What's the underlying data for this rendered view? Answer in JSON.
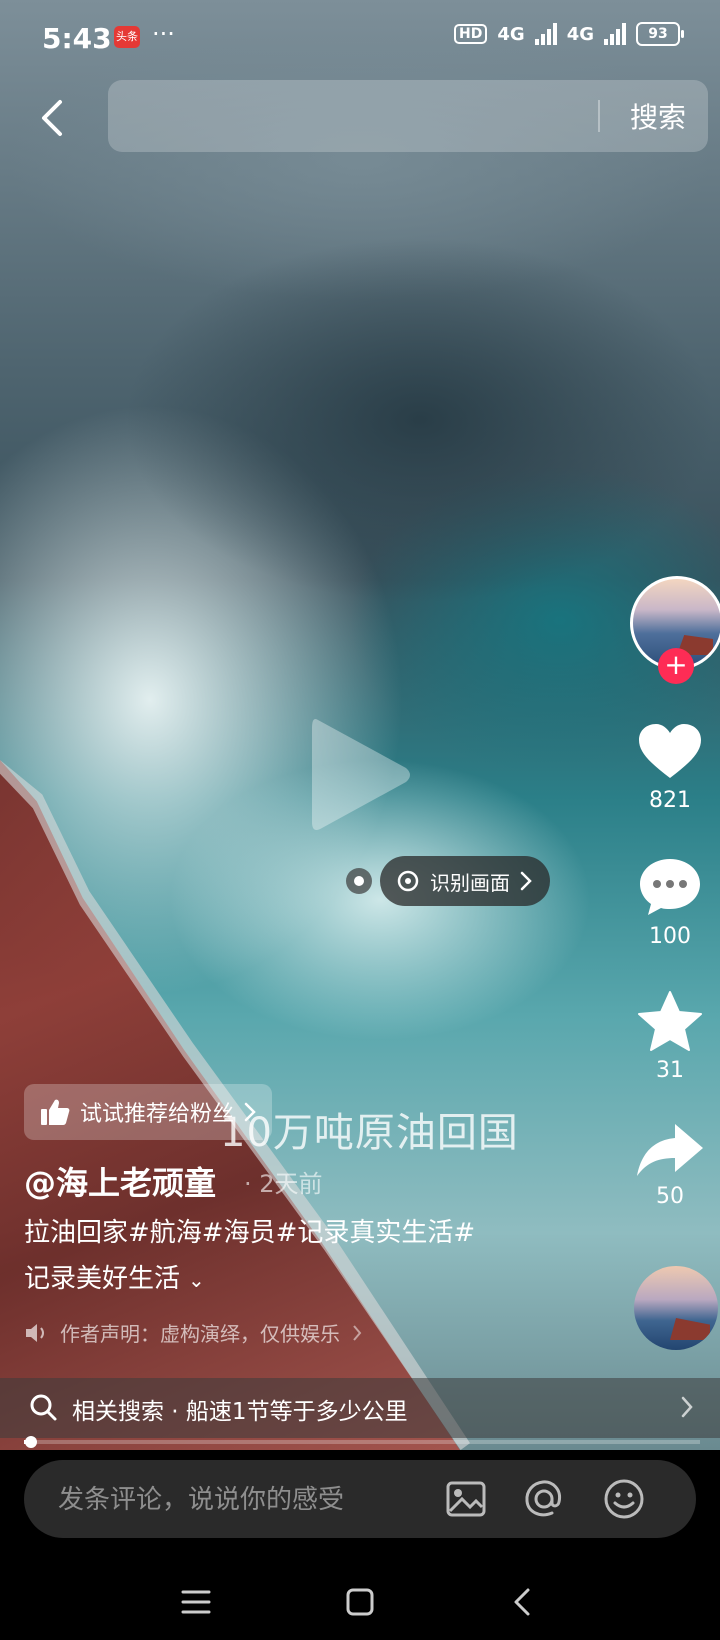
{
  "status_bar": {
    "time": "5:43",
    "app_badge": "头条",
    "more": "···",
    "hd": "HD",
    "net1": "4G",
    "net2": "4G",
    "battery": "93"
  },
  "search": {
    "placeholder": "",
    "button_label": "搜索"
  },
  "video": {
    "identify_label": "识别画面",
    "watermark": "10万吨原油回国"
  },
  "right_rail": {
    "likes": "821",
    "comments": "100",
    "favorites": "31",
    "shares": "50"
  },
  "post": {
    "recommend_label": "试试推荐给粉丝",
    "author": "@海上老顽童",
    "time_ago": "· 2天前",
    "description_line1": "拉油回家#航海#海员#记录真实生活#",
    "description_line2": "记录美好生活",
    "disclaimer": "作者声明：虚构演绎，仅供娱乐"
  },
  "related_search": {
    "label": "相关搜索 · 船速1节等于多少公里"
  },
  "progress": {
    "value": 0.01
  },
  "comment": {
    "placeholder": "发条评论，说说你的感受"
  },
  "colors": {
    "accent": "#fe2c55",
    "comment_bg": "#2a2a2a"
  }
}
